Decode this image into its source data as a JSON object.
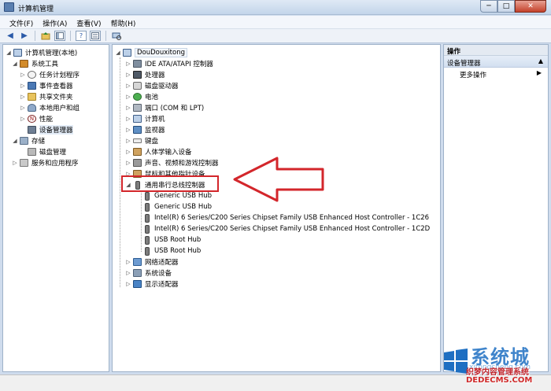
{
  "window": {
    "title": "计算机管理",
    "min": "─",
    "max": "□",
    "close": "✕"
  },
  "menu": [
    "文件(F)",
    "操作(A)",
    "查看(V)",
    "帮助(H)"
  ],
  "toolbar": {
    "back": "◀",
    "forward": "▶",
    "help_box": "?"
  },
  "left_tree": [
    {
      "label": "计算机管理(本地)",
      "icon": "computer-icon",
      "expander": "◢"
    },
    {
      "label": "系统工具",
      "icon": "tools-icon",
      "expander": "◢"
    },
    {
      "label": "任务计划程序",
      "icon": "clock-icon",
      "expander": "▷"
    },
    {
      "label": "事件查看器",
      "icon": "event-viewer-icon",
      "expander": "▷"
    },
    {
      "label": "共享文件夹",
      "icon": "folder-icon",
      "expander": "▷"
    },
    {
      "label": "本地用户和组",
      "icon": "users-icon",
      "expander": "▷"
    },
    {
      "label": "性能",
      "icon": "performance-icon",
      "expander": "▷"
    },
    {
      "label": "设备管理器",
      "icon": "device-manager-icon",
      "expander": ""
    },
    {
      "label": "存储",
      "icon": "storage-icon",
      "expander": "◢"
    },
    {
      "label": "磁盘管理",
      "icon": "disk-icon",
      "expander": ""
    },
    {
      "label": "服务和应用程序",
      "icon": "services-icon",
      "expander": "▷"
    }
  ],
  "device_tree": {
    "root": "DouDouxitong",
    "categories": [
      {
        "label": "IDE ATA/ATAPI 控制器",
        "icon": "ide-controller-icon"
      },
      {
        "label": "处理器",
        "icon": "processor-icon"
      },
      {
        "label": "磁盘驱动器",
        "icon": "disk-drive-icon"
      },
      {
        "label": "电池",
        "icon": "battery-icon"
      },
      {
        "label": "端口 (COM 和 LPT)",
        "icon": "port-icon"
      },
      {
        "label": "计算机",
        "icon": "computer-icon"
      },
      {
        "label": "监视器",
        "icon": "monitor-icon"
      },
      {
        "label": "键盘",
        "icon": "keyboard-icon"
      },
      {
        "label": "人体学输入设备",
        "icon": "hid-icon"
      },
      {
        "label": "声音、视频和游戏控制器",
        "icon": "sound-icon"
      },
      {
        "label": "鼠标和其他指针设备",
        "icon": "mouse-icon"
      }
    ],
    "usb_category": "通用串行总线控制器",
    "usb_children": [
      "Generic USB Hub",
      "Generic USB Hub",
      "Intel(R) 6 Series/C200 Series Chipset Family USB Enhanced Host Controller - 1C26",
      "Intel(R) 6 Series/C200 Series Chipset Family USB Enhanced Host Controller - 1C2D",
      "USB Root Hub",
      "USB Root Hub"
    ],
    "after_categories": [
      {
        "label": "网络适配器",
        "icon": "network-adapter-icon"
      },
      {
        "label": "系统设备",
        "icon": "system-devices-icon"
      },
      {
        "label": "显示适配器",
        "icon": "display-adapter-icon"
      }
    ]
  },
  "actions": {
    "header": "操作",
    "section": "设备管理器",
    "more": "更多操作"
  },
  "watermark": {
    "title": "系统城",
    "line_top": "xitongcheng.com",
    "line2": "织梦内容管理系统",
    "line3": "DEDECMS.COM"
  },
  "colors": {
    "highlight_red": "#d3262b",
    "accent_blue": "#1e6fc2"
  }
}
